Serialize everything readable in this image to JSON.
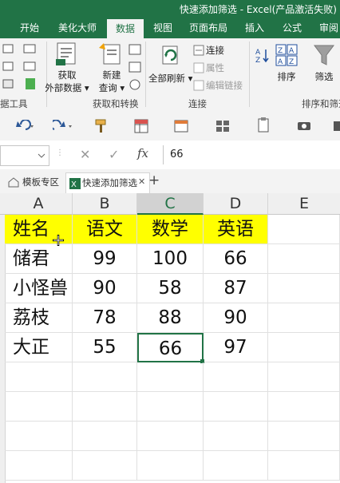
{
  "window": {
    "title": "快速添加筛选 - Excel(产品激活失败)"
  },
  "tabs": [
    "开始",
    "美化大师",
    "数据",
    "视图",
    "页面布局",
    "插入",
    "公式",
    "审阅"
  ],
  "active_tab": "数据",
  "ribbon": {
    "get_external": [
      "获取",
      "外部数据 ▾"
    ],
    "new_query": [
      "新建",
      "查询 ▾"
    ],
    "refresh_all": "全部刷新 ▾",
    "connections": "连接",
    "properties": "属性",
    "edit_links": "编辑链接",
    "sort": "排序",
    "filter": "筛选",
    "group_left": "据工具",
    "group_get_transform": "获取和转换",
    "group_connections": "连接",
    "group_sort_filter": "排序和筛选"
  },
  "formula_bar": {
    "cancel": "✕",
    "enter": "✓",
    "fx": "fx",
    "value": "66"
  },
  "sheet_tabs": [
    {
      "label": "模板专区"
    },
    {
      "label": "快速添加筛选",
      "close": "✕"
    }
  ],
  "add_sheet": "+",
  "columns": [
    "A",
    "B",
    "C",
    "D",
    "E"
  ],
  "header_row": [
    "姓名",
    "语文",
    "数学",
    "英语"
  ],
  "rows": [
    [
      "储君",
      "99",
      "100",
      "66"
    ],
    [
      "小怪兽",
      "90",
      "58",
      "87"
    ],
    [
      "荔枝",
      "78",
      "88",
      "90"
    ],
    [
      "大正",
      "55",
      "66",
      "97"
    ]
  ],
  "colors": {
    "excel_green": "#217346",
    "header_fill": "#ffff00"
  }
}
